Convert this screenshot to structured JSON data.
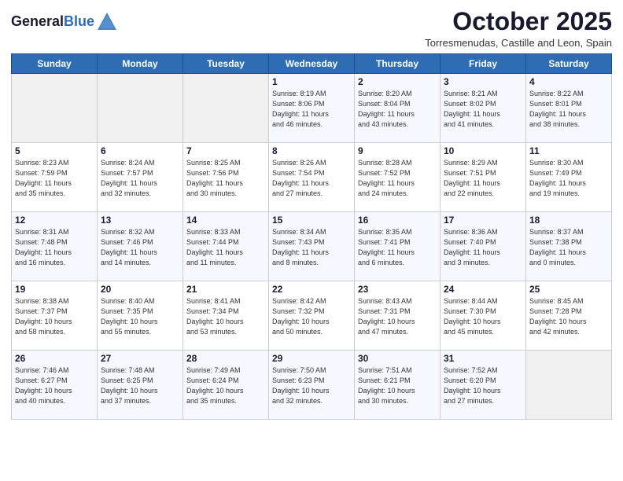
{
  "header": {
    "title": "October 2025",
    "subtitle": "Torresmenudas, Castille and Leon, Spain"
  },
  "days": [
    "Sunday",
    "Monday",
    "Tuesday",
    "Wednesday",
    "Thursday",
    "Friday",
    "Saturday"
  ],
  "weeks": [
    [
      {
        "num": "",
        "info": ""
      },
      {
        "num": "",
        "info": ""
      },
      {
        "num": "",
        "info": ""
      },
      {
        "num": "1",
        "info": "Sunrise: 8:19 AM\nSunset: 8:06 PM\nDaylight: 11 hours\nand 46 minutes."
      },
      {
        "num": "2",
        "info": "Sunrise: 8:20 AM\nSunset: 8:04 PM\nDaylight: 11 hours\nand 43 minutes."
      },
      {
        "num": "3",
        "info": "Sunrise: 8:21 AM\nSunset: 8:02 PM\nDaylight: 11 hours\nand 41 minutes."
      },
      {
        "num": "4",
        "info": "Sunrise: 8:22 AM\nSunset: 8:01 PM\nDaylight: 11 hours\nand 38 minutes."
      }
    ],
    [
      {
        "num": "5",
        "info": "Sunrise: 8:23 AM\nSunset: 7:59 PM\nDaylight: 11 hours\nand 35 minutes."
      },
      {
        "num": "6",
        "info": "Sunrise: 8:24 AM\nSunset: 7:57 PM\nDaylight: 11 hours\nand 32 minutes."
      },
      {
        "num": "7",
        "info": "Sunrise: 8:25 AM\nSunset: 7:56 PM\nDaylight: 11 hours\nand 30 minutes."
      },
      {
        "num": "8",
        "info": "Sunrise: 8:26 AM\nSunset: 7:54 PM\nDaylight: 11 hours\nand 27 minutes."
      },
      {
        "num": "9",
        "info": "Sunrise: 8:28 AM\nSunset: 7:52 PM\nDaylight: 11 hours\nand 24 minutes."
      },
      {
        "num": "10",
        "info": "Sunrise: 8:29 AM\nSunset: 7:51 PM\nDaylight: 11 hours\nand 22 minutes."
      },
      {
        "num": "11",
        "info": "Sunrise: 8:30 AM\nSunset: 7:49 PM\nDaylight: 11 hours\nand 19 minutes."
      }
    ],
    [
      {
        "num": "12",
        "info": "Sunrise: 8:31 AM\nSunset: 7:48 PM\nDaylight: 11 hours\nand 16 minutes."
      },
      {
        "num": "13",
        "info": "Sunrise: 8:32 AM\nSunset: 7:46 PM\nDaylight: 11 hours\nand 14 minutes."
      },
      {
        "num": "14",
        "info": "Sunrise: 8:33 AM\nSunset: 7:44 PM\nDaylight: 11 hours\nand 11 minutes."
      },
      {
        "num": "15",
        "info": "Sunrise: 8:34 AM\nSunset: 7:43 PM\nDaylight: 11 hours\nand 8 minutes."
      },
      {
        "num": "16",
        "info": "Sunrise: 8:35 AM\nSunset: 7:41 PM\nDaylight: 11 hours\nand 6 minutes."
      },
      {
        "num": "17",
        "info": "Sunrise: 8:36 AM\nSunset: 7:40 PM\nDaylight: 11 hours\nand 3 minutes."
      },
      {
        "num": "18",
        "info": "Sunrise: 8:37 AM\nSunset: 7:38 PM\nDaylight: 11 hours\nand 0 minutes."
      }
    ],
    [
      {
        "num": "19",
        "info": "Sunrise: 8:38 AM\nSunset: 7:37 PM\nDaylight: 10 hours\nand 58 minutes."
      },
      {
        "num": "20",
        "info": "Sunrise: 8:40 AM\nSunset: 7:35 PM\nDaylight: 10 hours\nand 55 minutes."
      },
      {
        "num": "21",
        "info": "Sunrise: 8:41 AM\nSunset: 7:34 PM\nDaylight: 10 hours\nand 53 minutes."
      },
      {
        "num": "22",
        "info": "Sunrise: 8:42 AM\nSunset: 7:32 PM\nDaylight: 10 hours\nand 50 minutes."
      },
      {
        "num": "23",
        "info": "Sunrise: 8:43 AM\nSunset: 7:31 PM\nDaylight: 10 hours\nand 47 minutes."
      },
      {
        "num": "24",
        "info": "Sunrise: 8:44 AM\nSunset: 7:30 PM\nDaylight: 10 hours\nand 45 minutes."
      },
      {
        "num": "25",
        "info": "Sunrise: 8:45 AM\nSunset: 7:28 PM\nDaylight: 10 hours\nand 42 minutes."
      }
    ],
    [
      {
        "num": "26",
        "info": "Sunrise: 7:46 AM\nSunset: 6:27 PM\nDaylight: 10 hours\nand 40 minutes."
      },
      {
        "num": "27",
        "info": "Sunrise: 7:48 AM\nSunset: 6:25 PM\nDaylight: 10 hours\nand 37 minutes."
      },
      {
        "num": "28",
        "info": "Sunrise: 7:49 AM\nSunset: 6:24 PM\nDaylight: 10 hours\nand 35 minutes."
      },
      {
        "num": "29",
        "info": "Sunrise: 7:50 AM\nSunset: 6:23 PM\nDaylight: 10 hours\nand 32 minutes."
      },
      {
        "num": "30",
        "info": "Sunrise: 7:51 AM\nSunset: 6:21 PM\nDaylight: 10 hours\nand 30 minutes."
      },
      {
        "num": "31",
        "info": "Sunrise: 7:52 AM\nSunset: 6:20 PM\nDaylight: 10 hours\nand 27 minutes."
      },
      {
        "num": "",
        "info": ""
      }
    ]
  ]
}
